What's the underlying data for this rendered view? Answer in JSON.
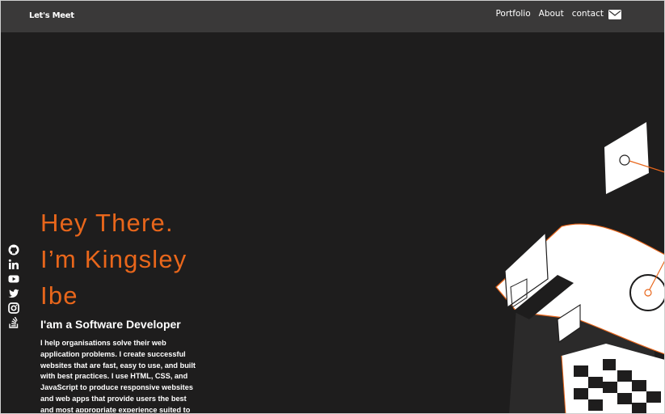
{
  "navbar": {
    "brand": "Let's Meet",
    "links": [
      "Portfolio",
      "About",
      "contact"
    ],
    "contact_icon": "mail-icon"
  },
  "social": {
    "icons": [
      "github-icon",
      "linkedin-icon",
      "youtube-icon",
      "twitter-icon",
      "instagram-icon",
      "stackoverflow-icon"
    ]
  },
  "hero": {
    "title_line1": "Hey There.",
    "title_line2": "I’m Kingsley",
    "title_line3": "Ibe",
    "subtitle": "I'am a Software Developer",
    "description": "I help organisations solve their web application problems. I create successful websites that are fast, easy to use, and built with best practices. I use HTML, CSS, and JavaScript to produce responsive websites and web apps that provide users the best and most appropriate experience suited to their needs."
  },
  "colors": {
    "background": "#1e1d1d",
    "navbar": "#3a3939",
    "accent": "#e8661b",
    "text": "#ffffff"
  }
}
